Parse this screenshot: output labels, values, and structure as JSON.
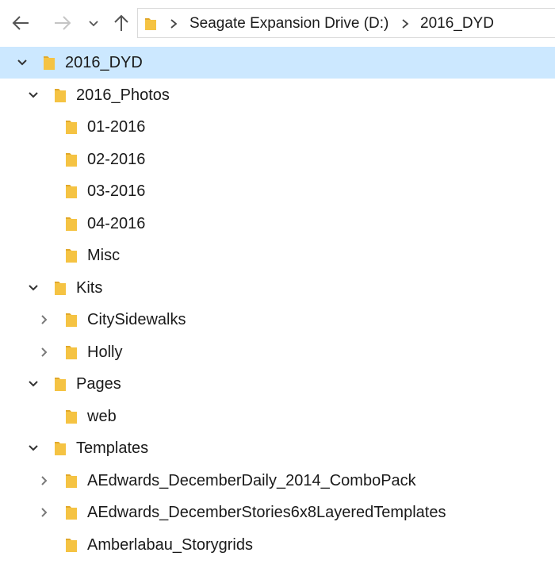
{
  "toolbar": {
    "back_icon": "arrow-left-icon",
    "forward_icon": "arrow-right-icon",
    "recent_icon": "chevron-down-icon",
    "up_icon": "arrow-up-icon"
  },
  "address": {
    "crumbs": [
      "Seagate Expansion Drive (D:)",
      "2016_DYD"
    ]
  },
  "colors": {
    "selection": "#cce8ff",
    "folder": "#f5c343",
    "folder_dark": "#e1a82a",
    "text": "#1a1a1a"
  },
  "tree": [
    {
      "label": "2016_DYD",
      "state": "expanded",
      "selected": true
    },
    {
      "label": "2016_Photos",
      "state": "expanded"
    },
    {
      "label": "01-2016",
      "state": "leaf"
    },
    {
      "label": "02-2016",
      "state": "leaf"
    },
    {
      "label": "03-2016",
      "state": "leaf"
    },
    {
      "label": "04-2016",
      "state": "leaf"
    },
    {
      "label": "Misc",
      "state": "leaf"
    },
    {
      "label": "Kits",
      "state": "expanded"
    },
    {
      "label": "CitySidewalks",
      "state": "collapsed"
    },
    {
      "label": "Holly",
      "state": "collapsed"
    },
    {
      "label": "Pages",
      "state": "expanded"
    },
    {
      "label": "web",
      "state": "leaf"
    },
    {
      "label": "Templates",
      "state": "expanded"
    },
    {
      "label": "AEdwards_DecemberDaily_2014_ComboPack",
      "state": "collapsed"
    },
    {
      "label": "AEdwards_DecemberStories6x8LayeredTemplates",
      "state": "collapsed"
    },
    {
      "label": "Amberlabau_Storygrids",
      "state": "leaf"
    }
  ]
}
